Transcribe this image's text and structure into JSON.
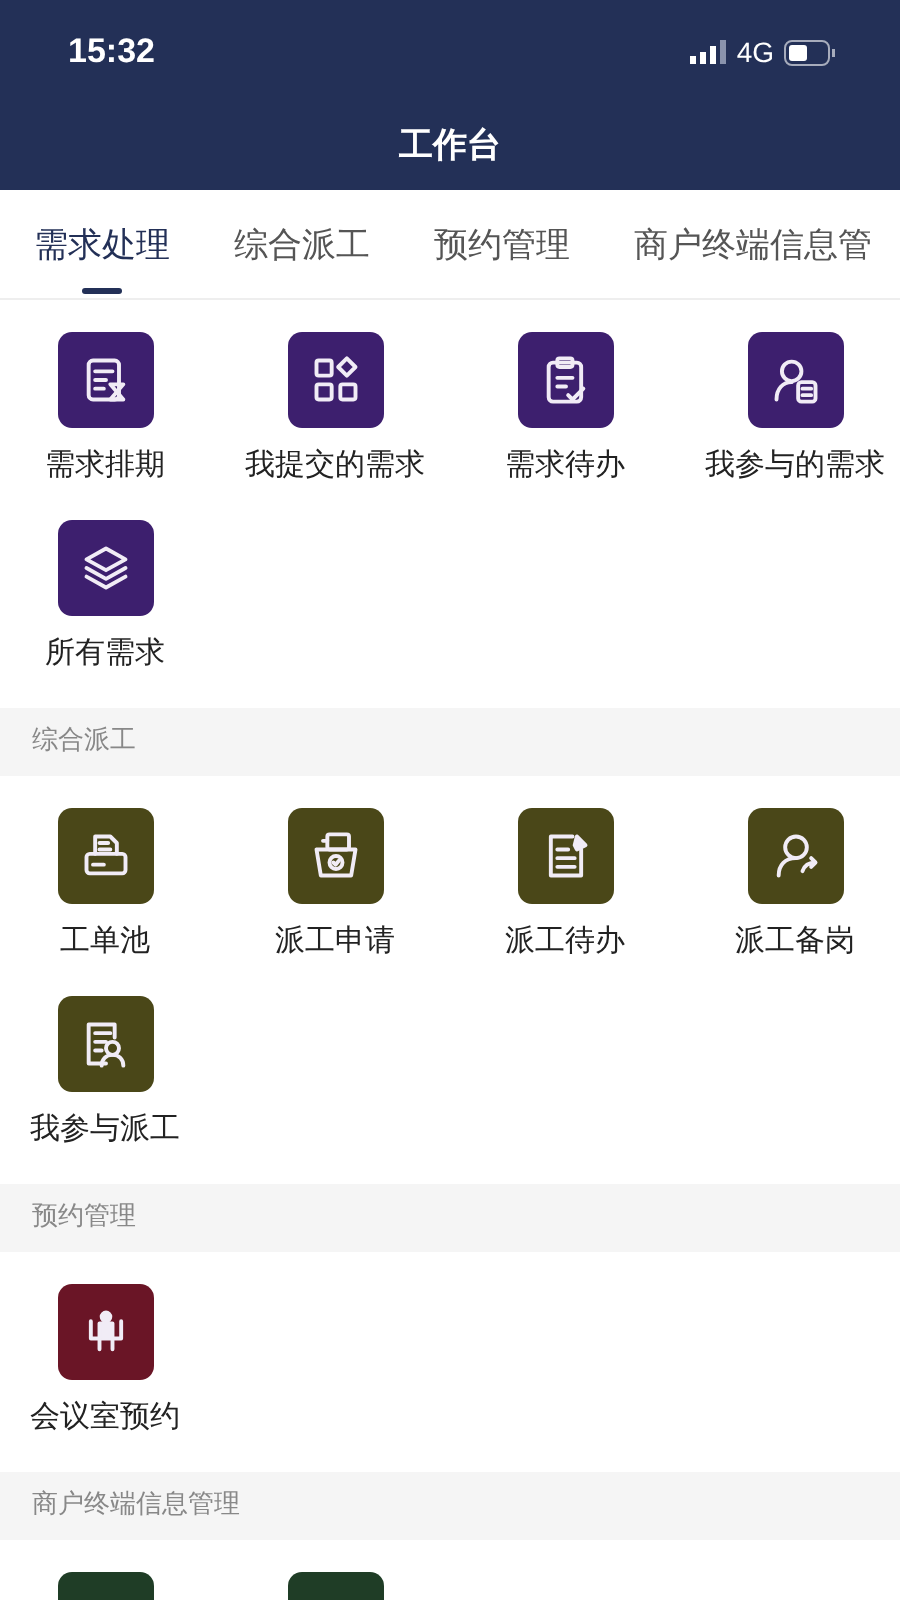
{
  "status_bar": {
    "time": "15:32",
    "network": "4G"
  },
  "header": {
    "title": "工作台"
  },
  "tabs": [
    {
      "label": "需求处理",
      "selected": true
    },
    {
      "label": "综合派工",
      "selected": false
    },
    {
      "label": "预约管理",
      "selected": false
    },
    {
      "label": "商户终端信息管",
      "selected": false
    }
  ],
  "sections": [
    {
      "color": "#3d1f6e",
      "items": [
        {
          "kind": "labeled",
          "label": "需求排期"
        },
        {
          "kind": "labeled",
          "label": "我提交的需求"
        },
        {
          "kind": "labeled",
          "label": "需求待办"
        },
        {
          "kind": "labeled",
          "label": "我参与的需求"
        },
        {
          "kind": "labeled",
          "label": "所有需求"
        }
      ]
    },
    {
      "title": "综合派工",
      "color": "#4a4718",
      "items": [
        {
          "kind": "labeled",
          "label": "工单池"
        },
        {
          "kind": "labeled",
          "label": "派工申请"
        },
        {
          "kind": "labeled",
          "label": "派工待办"
        },
        {
          "kind": "labeled",
          "label": "派工备岗"
        },
        {
          "kind": "labeled",
          "label": "我参与派工"
        }
      ]
    },
    {
      "title": "预约管理",
      "color": "#6a1526",
      "items": [
        {
          "kind": "labeled",
          "label": "会议室预约"
        }
      ]
    },
    {
      "title": "商户终端信息管理",
      "color": "#1f3d26",
      "items": [
        {
          "kind": "tile_only"
        },
        {
          "kind": "tile_only"
        }
      ]
    }
  ]
}
